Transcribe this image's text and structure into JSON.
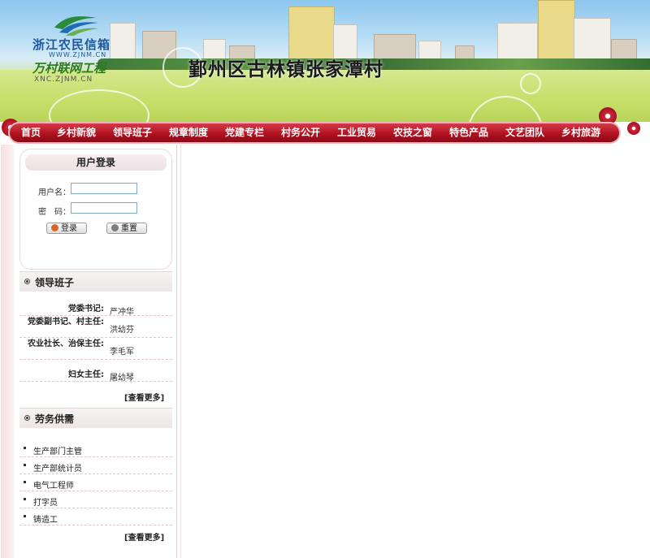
{
  "logo": {
    "line1": "浙江农民信箱",
    "line2": "WWW.ZJNM.CN",
    "line3": "万村联网工程",
    "line4": "XNC.ZJNM.CN"
  },
  "site_title": "鄞州区古林镇张家潭村",
  "nav": {
    "items": [
      "首页",
      "乡村新貌",
      "领导班子",
      "规章制度",
      "党建专栏",
      "村务公开",
      "工业贸易",
      "农技之窗",
      "特色产品",
      "文艺团队",
      "乡村旅游"
    ]
  },
  "login": {
    "title": "用户登录",
    "username_label": "用户名：",
    "password_label": "密　码：",
    "username_value": "",
    "password_value": "",
    "login_button": "登录",
    "reset_button": "重置"
  },
  "leadership": {
    "title": "领导班子",
    "rows": [
      {
        "role": "党委书记:",
        "name": "严冲华"
      },
      {
        "role": "党委副书记、村主任:",
        "name": "洪幼芬"
      },
      {
        "role": "农业社长、治保主任:",
        "name": "李毛军"
      },
      {
        "role": "妇女主任:",
        "name": "屠幼琴"
      }
    ],
    "more": "[查看更多]"
  },
  "labor": {
    "title": "劳务供需",
    "items": [
      "生产部门主管",
      "生产部统计员",
      "电气工程师",
      "打字员",
      "铸造工"
    ],
    "more": "[查看更多]"
  },
  "colors": {
    "nav_red": "#b11220",
    "title_dark": "#1a1a1a",
    "logo_blue": "#1f5a9a",
    "logo_green": "#2b7a1e"
  }
}
